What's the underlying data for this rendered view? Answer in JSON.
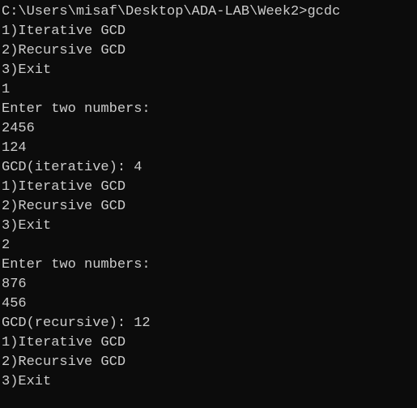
{
  "console": {
    "lines": [
      "C:\\Users\\misaf\\Desktop\\ADA-LAB\\Week2>gcdc",
      "1)Iterative GCD",
      "2)Recursive GCD",
      "3)Exit",
      "1",
      "Enter two numbers:",
      "2456",
      "124",
      "GCD(iterative): 4",
      "1)Iterative GCD",
      "2)Recursive GCD",
      "3)Exit",
      "2",
      "Enter two numbers:",
      "876",
      "456",
      "GCD(recursive): 12",
      "1)Iterative GCD",
      "2)Recursive GCD",
      "3)Exit"
    ],
    "colors": {
      "background": "#0c0c0c",
      "text": "#cccccc"
    }
  }
}
